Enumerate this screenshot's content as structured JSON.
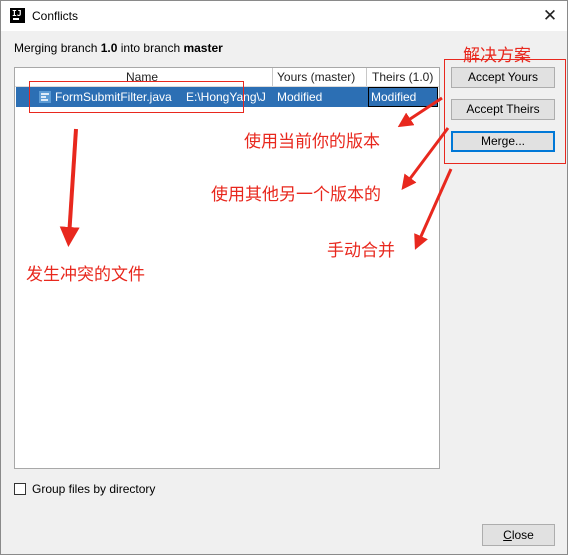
{
  "window": {
    "title": "Conflicts",
    "close_glyph": "✕"
  },
  "merge_info": {
    "prefix": "Merging branch ",
    "source_branch": "1.0",
    "middle": " into branch ",
    "target_branch": "master"
  },
  "table": {
    "columns": [
      "Name",
      "Yours (master)",
      "Theirs (1.0)"
    ],
    "rows": [
      {
        "file_name": "FormSubmitFilter.java",
        "path": "E:\\HongYang\\J",
        "yours": "Modified",
        "theirs": "Modified",
        "icon": "java-file-icon"
      }
    ]
  },
  "buttons": {
    "accept_yours": "Accept Yours",
    "accept_theirs": "Accept Theirs",
    "merge": "Merge..."
  },
  "options": {
    "group_by_directory_label": "Group files by directory",
    "group_by_directory_checked": false
  },
  "footer": {
    "close_mnemonic": "C",
    "close_rest": "lose"
  },
  "annotations": {
    "solutions": "解决方案",
    "use_current": "使用当前你的版本",
    "use_other": "使用其他另一个版本的",
    "manual_merge": "手动合并",
    "conflicted_files": "发生冲突的文件"
  },
  "colors": {
    "annotation_red": "#e8281e",
    "selection_blue": "#2c6fb4",
    "focus_blue": "#0078d7"
  }
}
